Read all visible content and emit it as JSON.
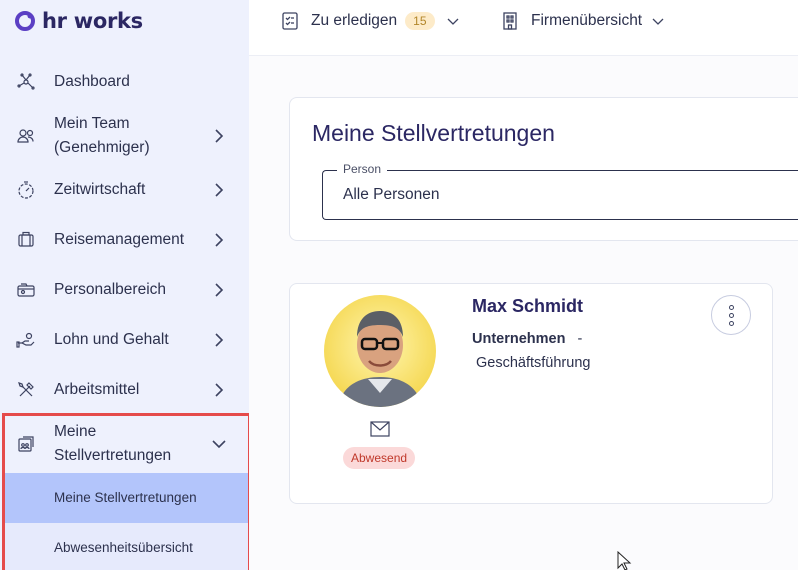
{
  "app": {
    "logo_text": "hr works"
  },
  "sidebar": {
    "items": [
      {
        "label": "Dashboard",
        "icon": "dashboard-icon",
        "has_chevron": false
      },
      {
        "label": "Mein Team (Genehmiger)",
        "icon": "team-icon",
        "has_chevron": true
      },
      {
        "label": "Zeitwirtschaft",
        "icon": "stopwatch-icon",
        "has_chevron": true
      },
      {
        "label": "Reisemanagement",
        "icon": "suitcase-icon",
        "has_chevron": true
      },
      {
        "label": "Personalbereich",
        "icon": "personnel-icon",
        "has_chevron": true
      },
      {
        "label": "Lohn und Gehalt",
        "icon": "hand-money-icon",
        "has_chevron": true
      },
      {
        "label": "Arbeitsmittel",
        "icon": "tools-icon",
        "has_chevron": true
      },
      {
        "label": "Meine Stellvertretungen",
        "icon": "substitution-icon",
        "has_chevron": true,
        "expanded": true
      }
    ],
    "subitems": [
      {
        "label": "Meine Stellvertretungen",
        "active": true
      },
      {
        "label": "Abwesenheitsübersicht",
        "active": false
      }
    ]
  },
  "topbar": {
    "todo_label": "Zu erledigen",
    "todo_count": "15",
    "company_label": "Firmenübersicht"
  },
  "main": {
    "title": "Meine Stellvertretungen",
    "filter": {
      "legend": "Person",
      "value": "Alle Personen"
    },
    "person": {
      "name": "Max Schmidt",
      "company": "Unternehmen",
      "separator": "-",
      "department": "Geschäftsführung",
      "status": "Abwesend"
    }
  },
  "colors": {
    "sidebar_bg": "#eef1fd",
    "active_sub_bg": "#b3c5fb",
    "highlight_border": "#e54b4b",
    "title_color": "#2b2763",
    "badge_bg": "#fdebc9",
    "status_bg": "#fbd9d9"
  }
}
